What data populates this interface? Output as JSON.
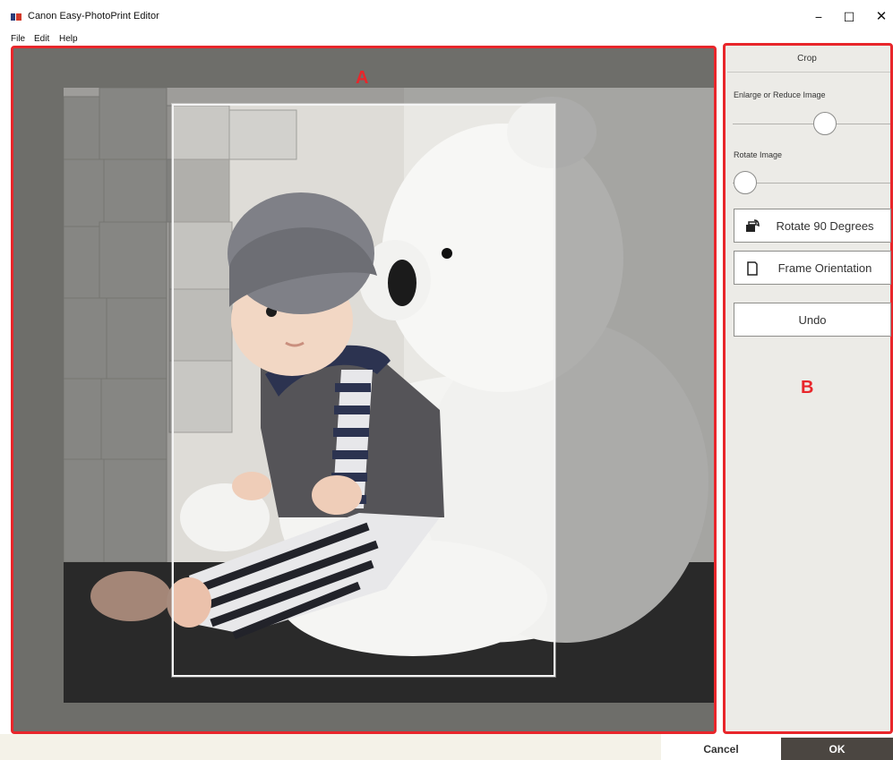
{
  "window": {
    "title": "Canon Easy-PhotoPrint Editor",
    "minimize_glyph": "−",
    "maximize_glyph": "☐",
    "close_glyph": "✕"
  },
  "menu": {
    "items": [
      "File",
      "Edit",
      "Help"
    ]
  },
  "canvas": {
    "area_label": "A"
  },
  "panel": {
    "area_label": "B",
    "title": "Crop",
    "enlarge_label": "Enlarge or Reduce Image",
    "rotate_label": "Rotate Image",
    "rotate90_label": "Rotate 90 Degrees",
    "frame_orientation_label": "Frame Orientation",
    "undo_label": "Undo"
  },
  "footer": {
    "cancel_label": "Cancel",
    "ok_label": "OK"
  },
  "colors": {
    "highlight": "#e8262b",
    "canvas_bg": "#6e6e6a",
    "panel_bg": "#ecebe7",
    "ok_bg": "#4b4641"
  },
  "icons": {
    "app": "app-logo-icon",
    "rotate90": "rotate-90-icon",
    "frame_orientation": "frame-orientation-icon"
  }
}
